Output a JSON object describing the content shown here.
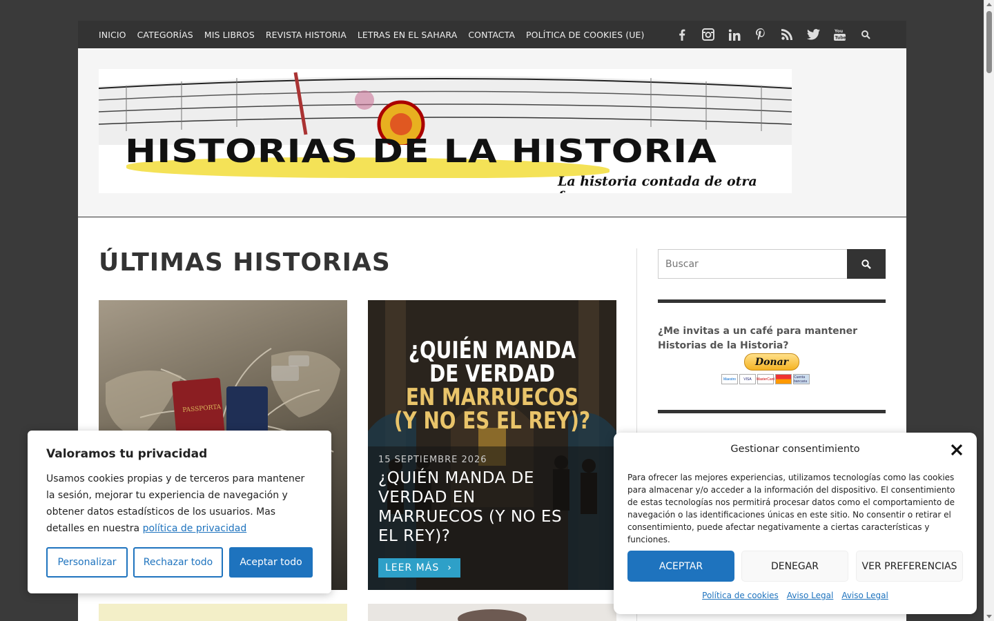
{
  "nav": {
    "items": [
      "INICIO",
      "CATEGORÍAS",
      "MIS LIBROS",
      "REVISTA HISTORIA",
      "LETRAS EN EL SAHARA",
      "CONTACTA",
      "POLÍTICA DE COOKIES (UE)"
    ],
    "social_icons": [
      "facebook-icon",
      "instagram-icon",
      "linkedin-icon",
      "pinterest-icon",
      "rss-icon",
      "twitter-icon",
      "youtube-icon",
      "search-icon"
    ]
  },
  "banner": {
    "logo_text": "HISTORIAS DE LA HISTORIA",
    "tagline": "La historia contada de otra forma"
  },
  "main": {
    "title": "ÚLTIMAS HISTORIAS",
    "featured": {
      "image_headline_white_1": "¿QUIÉN MANDA",
      "image_headline_white_2": "DE VERDAD",
      "image_headline_yellow_1": "EN MARRUECOS",
      "image_headline_yellow_2": "(Y NO ES EL REY)?",
      "date": "15 SEPTIEMBRE 2026",
      "title": "¿QUIÉN MANDA DE VERDAD EN MARRUECOS (Y NO ES EL REY)?",
      "read_more": "LEER MÁS"
    },
    "card1_image_label": "PASSPORTA"
  },
  "sidebar": {
    "search_placeholder": "Buscar",
    "coffee_text": "¿Me invitas a un café para mantener Historias de la Historia?",
    "donate_label": "Donar",
    "payment_cards": [
      "Maestro",
      "VISA",
      "MasterCard",
      "",
      "Cuenta bancaria"
    ]
  },
  "cookie_banner": {
    "title": "Valoramos tu privacidad",
    "text": "Usamos cookies propias y de terceros para mantener la sesión, mejorar tu experiencia de navegación y obtener datos estadísticos de los usuarios. Mas detalles en nuestra",
    "link": "política de privacidad",
    "customize": "Personalizar",
    "reject": "Rechazar todo",
    "accept": "Aceptar todo"
  },
  "consent_modal": {
    "title": "Gestionar consentimiento",
    "text": "Para ofrecer las mejores experiencias, utilizamos tecnologías como las cookies para almacenar y/o acceder a la información del dispositivo. El consentimiento de estas tecnologías nos permitirá procesar datos como el comportamiento de navegación o las identificaciones únicas en este sitio. No consentir o retirar el consentimiento, puede afectar negativamente a ciertas características y funciones.",
    "accept": "ACEPTAR",
    "deny": "DENEGAR",
    "preferences": "VER PREFERENCIAS",
    "links": [
      "Política de cookies",
      "Aviso Legal",
      "Aviso Legal"
    ]
  },
  "colors": {
    "nav_bg": "#333333",
    "accent_blue": "#1e73be",
    "read_more_bg": "#2ea0c8",
    "headline_yellow": "#e9c46a"
  }
}
